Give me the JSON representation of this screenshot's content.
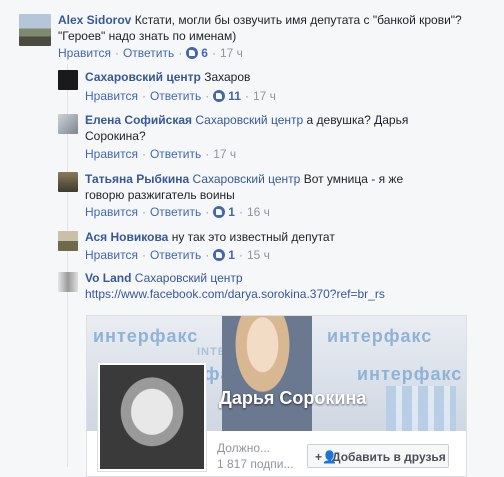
{
  "actions": {
    "like": "Нравится",
    "reply": "Ответить"
  },
  "comments": [
    {
      "author": "Alex Sidorov",
      "text": "Кстати, могли бы озвучить имя депутата с \"банкой крови\"? \"Героев\" надо знать по именам)",
      "likes": "6",
      "time": "17 ч"
    }
  ],
  "replies": [
    {
      "author": "Сахаровский центр",
      "mention": "",
      "text": "Захаров",
      "likes": "11",
      "time": "17 ч"
    },
    {
      "author": "Елена Софийская",
      "mention": "Сахаровский центр",
      "text": "а девушка? Дарья Сорокина?",
      "likes": "",
      "time": "17 ч"
    },
    {
      "author": "Татьяна Рыбкина",
      "mention": "Сахаровский центр",
      "text": "Вот умница - я же говорю разжигатель воины",
      "likes": "1",
      "time": "16 ч"
    },
    {
      "author": "Ася Новикова",
      "mention": "",
      "text": "ну так это известный депутат",
      "likes": "1",
      "time": "15 ч"
    },
    {
      "author": "Vo Land",
      "mention": "Сахаровский центр",
      "text": "https://www.facebook.com/darya.sorokina.370?ref=br_rs",
      "likes": "",
      "time": ""
    }
  ],
  "preview": {
    "page_name": "Дарья Сорокина",
    "sub1": "Должно...",
    "sub2": "1 817 подпи...",
    "add_friend": "Добавить в друзья",
    "watermark": "интерфакс",
    "watermark_small": "INTERFAX"
  },
  "colors": {
    "link": "#365899",
    "like_blue": "#4267b2",
    "meta_gray": "#90949c"
  }
}
